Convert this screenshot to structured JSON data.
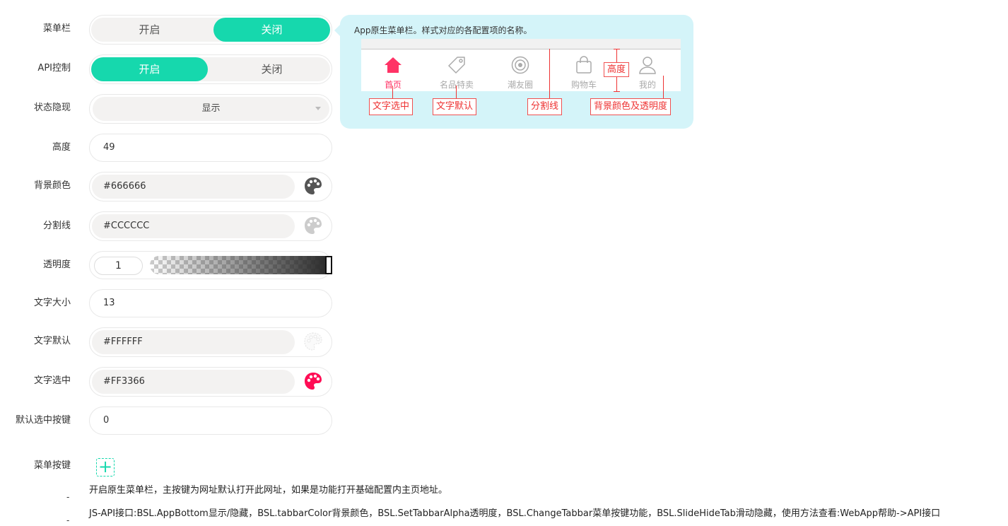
{
  "form": {
    "menubar": {
      "label": "菜单栏",
      "options": [
        "开启",
        "关闭"
      ],
      "selected": "关闭"
    },
    "api_control": {
      "label": "API控制",
      "options": [
        "开启",
        "关闭"
      ],
      "selected": "开启"
    },
    "status_visibility": {
      "label": "状态隐现",
      "value": "显示"
    },
    "height": {
      "label": "高度",
      "value": "49"
    },
    "bg_color": {
      "label": "背景颜色",
      "value": "#666666",
      "swatch": "#555555"
    },
    "divider": {
      "label": "分割线",
      "value": "#CCCCCC",
      "swatch": "#cccccc"
    },
    "opacity": {
      "label": "透明度",
      "value": "1",
      "level": 1
    },
    "font_size": {
      "label": "文字大小",
      "value": "13"
    },
    "text_default": {
      "label": "文字默认",
      "value": "#FFFFFF",
      "swatch": "#f4f4f4"
    },
    "text_selected": {
      "label": "文字选中",
      "value": "#FF3366",
      "swatch": "#ff0d55"
    },
    "default_selected_button": {
      "label": "默认选中按键",
      "value": "0"
    },
    "menu_buttons": {
      "label": "菜单按键",
      "add_icon": "plus-icon"
    }
  },
  "notes": [
    "开启原生菜单栏，主按键为网址默认打开此网址，如果是功能打开基础配置内主页地址。",
    "JS-API接口:BSL.AppBottom显示/隐藏，BSL.tabbarColor背景颜色，BSL.SetTabbarAlpha透明度，BSL.ChangeTabbar菜单按键功能，BSL.SlideHideTab滑动隐藏，使用方法查看:WebApp帮助->API接口"
  ],
  "dash": "-",
  "preview": {
    "title": "App原生菜单栏。样式对应的各配置项的名称。",
    "tabs": [
      {
        "label": "首页",
        "icon": "home-icon",
        "active": true
      },
      {
        "label": "名品特卖",
        "icon": "tag-icon",
        "active": false
      },
      {
        "label": "潮友圈",
        "icon": "circle-target-icon",
        "active": false
      },
      {
        "label": "购物车",
        "icon": "shopping-bag-icon",
        "active": false
      },
      {
        "label": "我的",
        "icon": "user-icon",
        "active": false
      }
    ],
    "callouts": {
      "text_selected": "文字选中",
      "text_default": "文字默认",
      "divider": "分割线",
      "height": "高度",
      "bg_opacity": "背景颜色及透明度"
    }
  },
  "colors": {
    "accent": "#16d8ad",
    "active_text": "#ff3366",
    "callout": "#e33333",
    "preview_bg": "#d4f4f9"
  }
}
